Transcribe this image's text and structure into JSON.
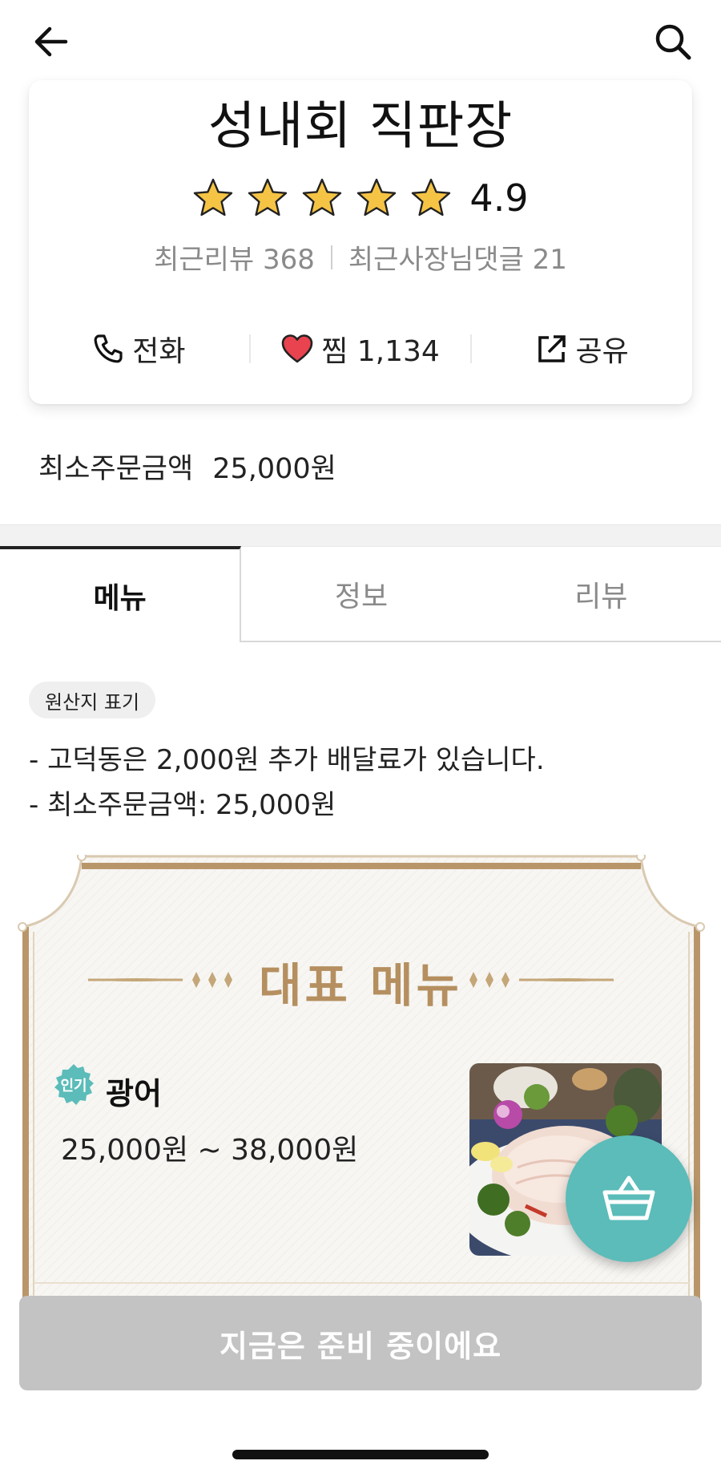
{
  "header": {
    "back_icon": "arrow-left-icon",
    "search_icon": "search-icon"
  },
  "store": {
    "name": "성내회 직판장",
    "rating": "4.9",
    "stars": 5,
    "recent_reviews_label": "최근리뷰 368",
    "owner_replies_label": "최근사장님댓글 21",
    "actions": {
      "call_label": "전화",
      "like_label": "찜 1,134",
      "share_label": "공유"
    }
  },
  "min_order": {
    "label": "최소주문금액",
    "value": "25,000원"
  },
  "tabs": [
    {
      "label": "메뉴",
      "active": true
    },
    {
      "label": "정보",
      "active": false
    },
    {
      "label": "리뷰",
      "active": false
    }
  ],
  "origin_badge": "원산지 표기",
  "notices": [
    "- 고덕동은 2,000원 추가 배달료가 있습니다.",
    "- 최소주문금액: 25,000원"
  ],
  "featured": {
    "title": "대표 메뉴",
    "items": [
      {
        "badge": "인기",
        "name": "광어",
        "price": "25,000원 ~ 38,000원"
      }
    ]
  },
  "bottom_button": "지금은 준비 중이에요",
  "colors": {
    "accent_teal": "#5bbcb9",
    "gold": "#b58f5f",
    "star_fill": "#f6c445",
    "heart": "#e8434f",
    "disabled_button": "#c3c3c3"
  }
}
